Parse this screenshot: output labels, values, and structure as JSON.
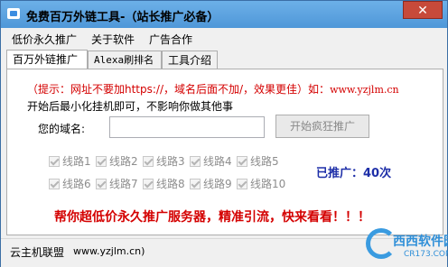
{
  "window": {
    "title": "免费百万外链工具-（站长推广必备）",
    "close": "✕"
  },
  "menu": [
    "低价永久推广",
    "关于软件",
    "广告合作"
  ],
  "tabs": [
    "百万外链推广",
    "Alexa刷排名",
    "工具介绍"
  ],
  "tip": {
    "prefix": "（提示：网址不要加https://，域名后面不加/，效果更佳）如：",
    "example": "www.yzjlm.cn"
  },
  "subtip": "开始后最小化挂机即可，不影响你做其他事",
  "domain": {
    "label": "您的域名:",
    "value": ""
  },
  "start_button": "开始疯狂推广",
  "routes": [
    "线路1",
    "线路2",
    "线路3",
    "线路4",
    "线路5",
    "线路6",
    "线路7",
    "线路8",
    "线路9",
    "线路10"
  ],
  "promoted": "已推广：40次",
  "promo": "帮你超低价永久推广服务器，精准引流，快来看看！！！",
  "status": {
    "name": "云主机联盟",
    "url": "www.yzjlm.cn)"
  },
  "watermark": {
    "text": "西西软件园",
    "sub": "CR173.COM"
  }
}
